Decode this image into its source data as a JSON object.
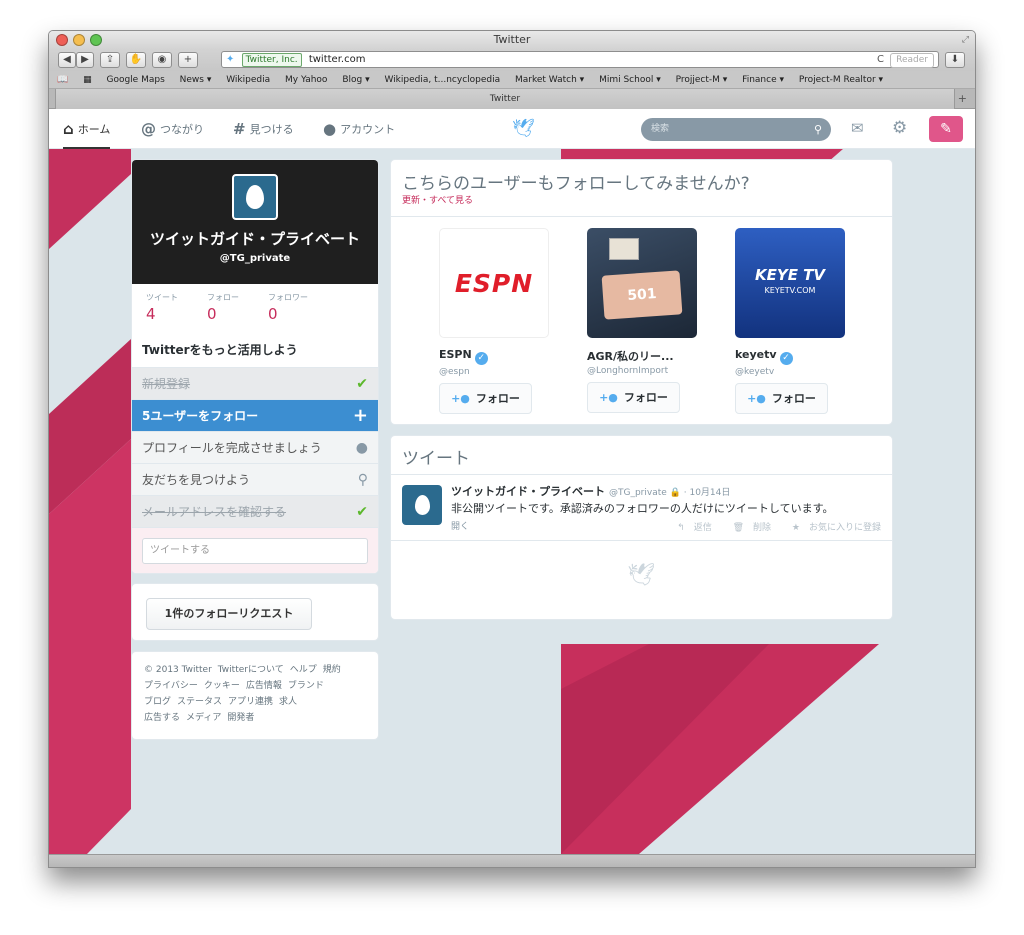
{
  "window": {
    "title": "Twitter"
  },
  "toolbar": {
    "back": "◀",
    "forward": "▶",
    "share": "⇪",
    "add": "+",
    "address": {
      "site_badge": "Twitter, Inc.",
      "url": "twitter.com"
    },
    "reload": "C",
    "reader": "Reader"
  },
  "bookmarks": [
    "Google Maps",
    "News ▾",
    "Wikipedia",
    "My Yahoo",
    "Blog ▾",
    "Wikipedia, t...ncyclopedia",
    "Market Watch ▾",
    "Mimi School ▾",
    "Projject-M ▾",
    "Finance ▾",
    "Project-M Realtor ▾"
  ],
  "tab": {
    "title": "Twitter"
  },
  "nav": {
    "home": "ホーム",
    "connect": "つながり",
    "discover": "見つける",
    "account": "アカウント",
    "search_placeholder": "検索"
  },
  "profile": {
    "name": "ツイットガイド・プライベート",
    "handle": "@TG_private",
    "stats": [
      {
        "label": "ツイート",
        "value": "4"
      },
      {
        "label": "フォロー",
        "value": "0"
      },
      {
        "label": "フォロワー",
        "value": "0"
      }
    ],
    "get_more": "Twitterをもっと活用しよう",
    "steps": [
      {
        "label": "新規登録",
        "status": "done"
      },
      {
        "label": "5ユーザーをフォロー",
        "status": "active"
      },
      {
        "label": "プロフィールを完成させましょう",
        "status": "todo"
      },
      {
        "label": "友だちを見つけよう",
        "status": "todo"
      },
      {
        "label": "メールアドレスを確認する",
        "status": "done"
      }
    ],
    "tweet_placeholder": "ツイートする"
  },
  "follow_request": {
    "label": "1件のフォローリクエスト"
  },
  "footer": {
    "links": [
      "© 2013 Twitter",
      "Twitterについて",
      "ヘルプ",
      "規約",
      "プライバシー",
      "クッキー",
      "広告情報",
      "ブランド",
      "ブログ",
      "ステータス",
      "アプリ連携",
      "求人",
      "広告する",
      "メディア",
      "開発者"
    ]
  },
  "who_to_follow": {
    "title": "こちらのユーザーもフォローしてみませんか?",
    "refresh": "更新・すべて見る",
    "follow_label": "フォロー",
    "users": [
      {
        "name": "ESPN",
        "handle": "@espn",
        "verified": true,
        "logo": "ESPN"
      },
      {
        "name": "AGR/私のリー...",
        "handle": "@LonghornImport",
        "verified": false,
        "logo": "501"
      },
      {
        "name": "keyetv",
        "handle": "@keyetv",
        "verified": true,
        "logo": "KEYE TV",
        "logo_sub": "KEYETV.COM"
      }
    ]
  },
  "tweets": {
    "title": "ツイート",
    "items": [
      {
        "name": "ツイットガイド・プライベート",
        "handle": "@TG_private",
        "date": "10月14日",
        "text": "非公開ツイートです。承認済みのフォロワーの人だけにツイートしています。",
        "open": "開く",
        "actions": [
          "返信",
          "削除",
          "お気に入りに登録"
        ]
      }
    ]
  },
  "colors": {
    "accent": "#c62c5b",
    "blue": "#55acee",
    "background": "#dbe5ea",
    "nav_active_step": "#3c8ed1"
  }
}
